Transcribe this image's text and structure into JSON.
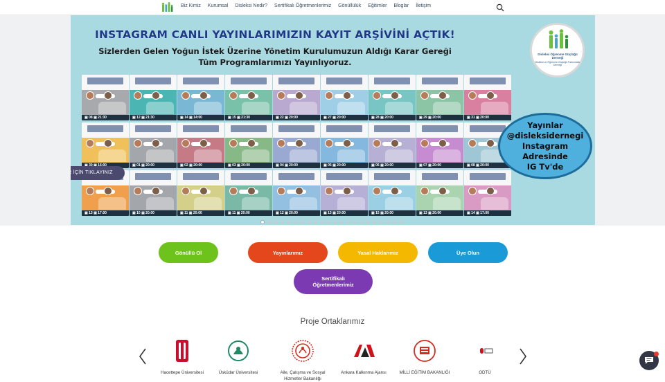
{
  "nav": {
    "items": [
      "Biz Kimiz",
      "Kurumsal",
      "Disleksi Nedir?",
      "Sertifikalı Öğretmenlerimiz",
      "Gönüllülük",
      "Eğitimler",
      "Bloglar",
      "İletişim"
    ],
    "search_icon": "search-icon",
    "logo_icon": "family-logo-icon"
  },
  "banner": {
    "headline": "INSTAGRAM CANLI YAYINLARIMIZIN KAYIT ARŞİVİNİ AÇTIK!",
    "subline1": "Sizlerden Gelen Yoğun İstek Üzerine Yönetim Kurulumuzun Aldığı Karar Gereği",
    "subline2": "Tüm Programlarımızı Yayınlıyoruz.",
    "org_name": "Disleksi Öğrenme Güçlüğü Derneği",
    "org_sub": "Disleksi ve Öğrenme Güçlüğü Farkındalık Derneği",
    "bubble_lines": [
      "Yayınlar",
      "@disleksidernegi",
      "Instagram",
      "Adresinde",
      "IG Tv'de"
    ],
    "detail_button": "DETAYLAR İÇİN TIKLAYINIZ",
    "tiles": [
      {
        "footer": "▣ 08 ▣ 21:30",
        "color": "#a7a9ad"
      },
      {
        "footer": "▣ 12 ▣ 21:30",
        "color": "#4bb5b3"
      },
      {
        "footer": "▣ 14 ▣ 14:00",
        "color": "#7ab7d4"
      },
      {
        "footer": "▣ 15 ▣ 21:30",
        "color": "#79c1a8"
      },
      {
        "footer": "▣ 22 ▣ 20:00",
        "color": "#b9a8cf"
      },
      {
        "footer": "▣ 27 ▣ 20:00",
        "color": "#9fcfe6"
      },
      {
        "footer": "▣ 28 ▣ 20:00",
        "color": "#79c5c3"
      },
      {
        "footer": "▣ 29 ▣ 20:00",
        "color": "#8bc5a5"
      },
      {
        "footer": "▣ 31 ▣ 20:00",
        "color": "#d97fa0"
      },
      {
        "footer": "▣ 30 ▣ 16:00",
        "color": "#f0c15a"
      },
      {
        "footer": "▣ 01 ▣ 20:00",
        "color": "#a3a6aa"
      },
      {
        "footer": "▣ 02 ▣ 20:00",
        "color": "#c57a86"
      },
      {
        "footer": "▣ 03 ▣ 20:00",
        "color": "#87b987"
      },
      {
        "footer": "▣ 04 ▣ 20:00",
        "color": "#9aa9d2"
      },
      {
        "footer": "▣ 05 ▣ 20:00",
        "color": "#84b8de"
      },
      {
        "footer": "▣ 06 ▣ 20:00",
        "color": "#b6b0d5"
      },
      {
        "footer": "▣ 07 ▣ 20:00",
        "color": "#c68bd0"
      },
      {
        "footer": "▣ 08 ▣ 20:00",
        "color": "#9fc6d4"
      },
      {
        "footer": "▣ 13 ▣ 17:00",
        "color": "#f0a04d"
      },
      {
        "footer": "▣ 10 ▣ 20:00",
        "color": "#a3a7ab"
      },
      {
        "footer": "▣ 11 ▣ 20:00",
        "color": "#d4d08a"
      },
      {
        "footer": "▣ 11 ▣ 20:00",
        "color": "#7ab9a6"
      },
      {
        "footer": "▣ 12 ▣ 20:00",
        "color": "#93bfe0"
      },
      {
        "footer": "▣ 13 ▣ 20:00",
        "color": "#b7b0d6"
      },
      {
        "footer": "▣ 15 ▣ 20:00",
        "color": "#9bcfe3"
      },
      {
        "footer": "▣ 13 ▣ 20:00",
        "color": "#aad4b0"
      },
      {
        "footer": "▣ 14 ▣ 17:00",
        "color": "#d99bc4"
      }
    ],
    "dot_count": 22,
    "active_dot": 0
  },
  "buttons": [
    {
      "label": "Gönüllü Ol",
      "color": "#6dc31b"
    },
    {
      "label": "Yayınlarımız",
      "color": "#e3471b"
    },
    {
      "label": "Yasal Haklarımız",
      "color": "#f4b800"
    },
    {
      "label": "Üye Olun",
      "color": "#1a9ad6"
    },
    {
      "label": "Sertifikalı Öğretmenlerimiz",
      "color": "#7b3ab2"
    }
  ],
  "partners_title": "Proje Ortaklarımız",
  "partners": [
    {
      "name": "Hacettepe Üniversitesi",
      "icon": "hacettepe-logo-icon"
    },
    {
      "name": "Üsküdar Üniversitesi",
      "icon": "uskudar-logo-icon"
    },
    {
      "name": "Aile, Çalışma ve Sosyal Hizmetler Bakanlığı",
      "icon": "ministry-family-logo-icon"
    },
    {
      "name": "Ankara Kalkınma Ajansı",
      "icon": "ankara-agency-logo-icon"
    },
    {
      "name": "MİLLİ EĞİTİM BAKANLIĞI",
      "icon": "meb-logo-icon"
    },
    {
      "name": "ODTÜ",
      "icon": "odtu-logo-icon"
    }
  ]
}
